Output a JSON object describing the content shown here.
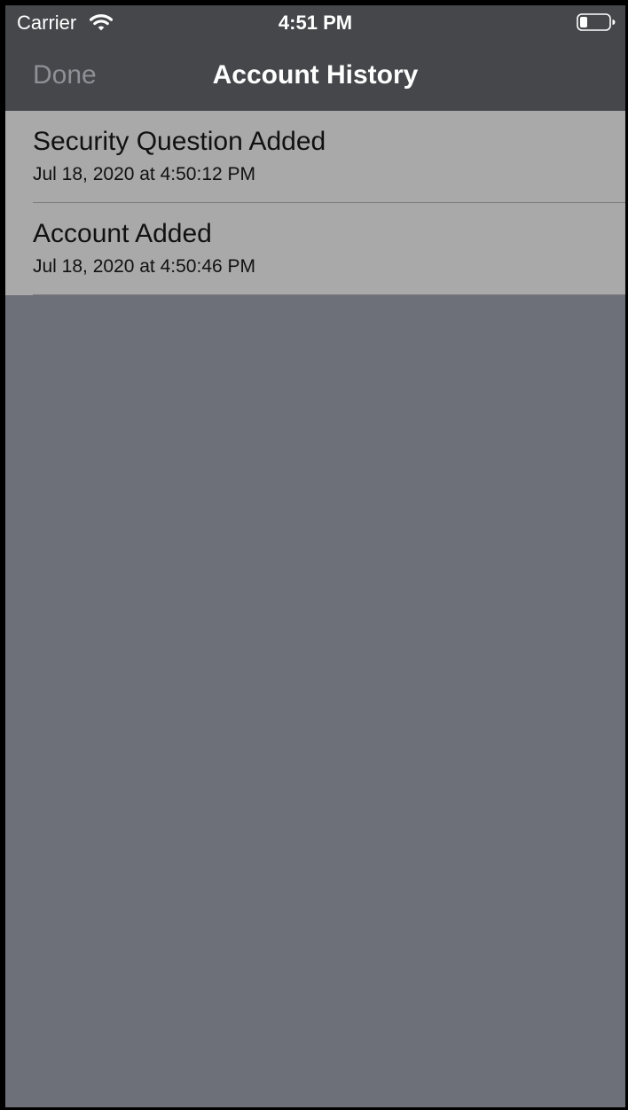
{
  "status_bar": {
    "carrier": "Carrier",
    "time": "4:51 PM",
    "wifi_icon": "wifi-icon",
    "battery_icon": "battery-low-icon"
  },
  "nav_bar": {
    "done_label": "Done",
    "title": "Account History"
  },
  "history": [
    {
      "event": "Security Question Added",
      "timestamp": "Jul 18, 2020 at 4:50:12 PM"
    },
    {
      "event": "Account Added",
      "timestamp": "Jul 18, 2020 at 4:50:46 PM"
    }
  ],
  "colors": {
    "bar_background": "#45474b",
    "row_background": "#a9a9a9",
    "screen_background": "#6d7078",
    "done_disabled": "#8e9095"
  }
}
